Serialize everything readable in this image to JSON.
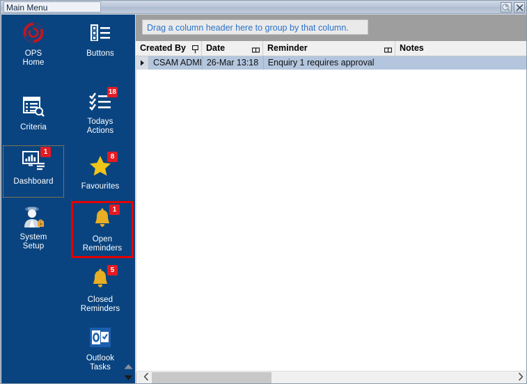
{
  "window": {
    "title": "Main Menu",
    "buttons": [
      {
        "name": "rollup-button",
        "icon": "pin-roll-icon"
      },
      {
        "name": "close-button",
        "icon": "close-icon"
      }
    ]
  },
  "sidebar": {
    "background_color": "#0a4480",
    "items": [
      {
        "label": "OPS\nHome",
        "label_line1": "OPS",
        "label_line2": "Home",
        "icon": "ops-logo-icon",
        "badge": null,
        "state": "normal"
      },
      {
        "label": "Buttons",
        "label_line1": "Buttons",
        "label_line2": "",
        "icon": "list-menu-icon",
        "badge": null,
        "state": "normal"
      },
      {
        "label": "Criteria",
        "label_line1": "Criteria",
        "label_line2": "",
        "icon": "document-search-icon",
        "badge": null,
        "state": "normal"
      },
      {
        "label": "Todays\nActions",
        "label_line1": "Todays",
        "label_line2": "Actions",
        "icon": "checklist-icon",
        "badge": "18",
        "state": "normal"
      },
      {
        "label": "Dashboard",
        "label_line1": "Dashboard",
        "label_line2": "",
        "icon": "dashboard-monitor-icon",
        "badge": "1",
        "state": "focused"
      },
      {
        "label": "Favourites",
        "label_line1": "Favourites",
        "label_line2": "",
        "icon": "star-icon",
        "badge": "8",
        "state": "normal"
      },
      {
        "label": "System\nSetup",
        "label_line1": "System",
        "label_line2": "Setup",
        "icon": "admin-user-icon",
        "badge": null,
        "state": "normal"
      },
      {
        "label": "Open\nReminders",
        "label_line1": "Open",
        "label_line2": "Reminders",
        "icon": "bell-icon",
        "badge": "1",
        "state": "highlighted"
      },
      {
        "label": "Closed\nReminders",
        "label_line1": "Closed",
        "label_line2": "Reminders",
        "icon": "bell-icon",
        "badge": "5",
        "state": "normal"
      },
      {
        "label": "Outlook\nTasks",
        "label_line1": "Outlook",
        "label_line2": "Tasks",
        "icon": "outlook-icon",
        "badge": null,
        "state": "normal"
      }
    ],
    "scroll_up_icon": "triangle-up-icon",
    "scroll_down_icon": "triangle-down-icon"
  },
  "main": {
    "group_panel": {
      "text": "Drag a column header here to group by that column.",
      "text_color": "#2a72c8"
    },
    "grid": {
      "columns": [
        {
          "header": "Created By",
          "has_split_glyph": true
        },
        {
          "header": "Date",
          "has_split_glyph": true
        },
        {
          "header": "Reminder",
          "has_split_glyph": true
        },
        {
          "header": "Notes",
          "has_split_glyph": false
        }
      ],
      "rows": [
        {
          "selected": true,
          "indicator": "row-pointer-icon",
          "created_by": "CSAM ADMI",
          "date": "26-Mar 13:18",
          "reminder": "Enquiry 1 requires approval",
          "notes": ""
        }
      ],
      "selected_row_color": "#b3c6de"
    },
    "hscroll": {
      "left_arrow": "chevron-left-icon",
      "right_arrow": "chevron-right-icon"
    }
  }
}
